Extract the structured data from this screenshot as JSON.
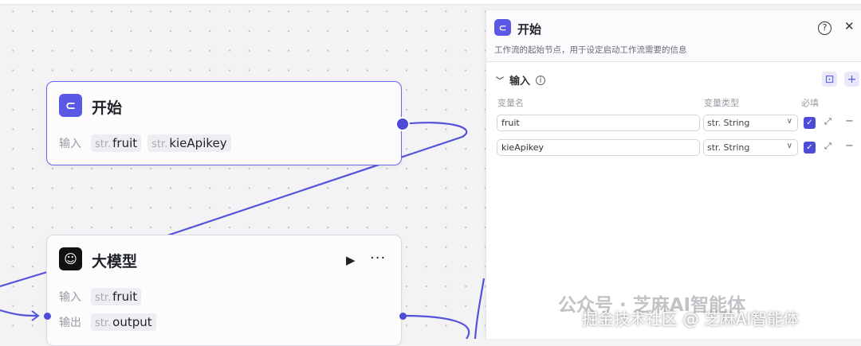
{
  "canvas": {
    "start_node": {
      "title": "开始",
      "input_label": "输入",
      "inputs": [
        {
          "type": "str.",
          "name": "fruit"
        },
        {
          "type": "str.",
          "name": "kieApikey"
        }
      ]
    },
    "llm_node": {
      "title": "大模型",
      "input_label": "输入",
      "output_label": "输出",
      "inputs": [
        {
          "type": "str.",
          "name": "fruit"
        }
      ],
      "outputs": [
        {
          "type": "str.",
          "name": "output"
        }
      ]
    }
  },
  "panel": {
    "title": "开始",
    "description": "工作流的起始节点，用于设定启动工作流需要的信息",
    "section_title": "输入",
    "columns": {
      "name": "变量名",
      "type": "变量类型",
      "required": "必填"
    },
    "variables": [
      {
        "name": "fruit",
        "type": "str. String",
        "required": true
      },
      {
        "name": "kieApikey",
        "type": "str. String",
        "required": true
      }
    ]
  },
  "watermark": {
    "line1": "公众号 · 芝麻AI智能体",
    "line2": "掘金技术社区 @ 芝麻AI智能体"
  },
  "colors": {
    "accent": "#4f4bd9"
  }
}
